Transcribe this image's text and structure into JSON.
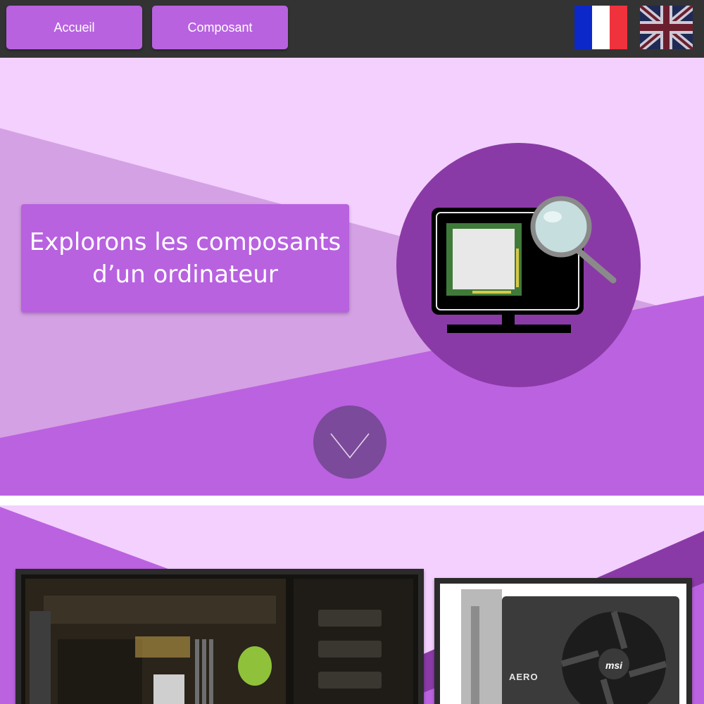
{
  "nav": {
    "home_label": "Accueil",
    "component_label": "Composant"
  },
  "languages": {
    "french": "Français",
    "english": "English"
  },
  "hero": {
    "title": "Explorons les composants\nd’un ordinateur"
  },
  "gpu_card": {
    "brand_text": "msi",
    "model_text": "AERO"
  },
  "colors": {
    "topbar": "#333333",
    "accent": "#b862e0",
    "light_bg": "#f3d0fd",
    "mid_bg": "#d4a1e4",
    "circle": "#8a3aa6",
    "scroll_button": "#7b4a9a"
  },
  "icons": {
    "scroll": "chevron-down-icon",
    "illustration": "monitor-chip-magnifier-icon"
  }
}
